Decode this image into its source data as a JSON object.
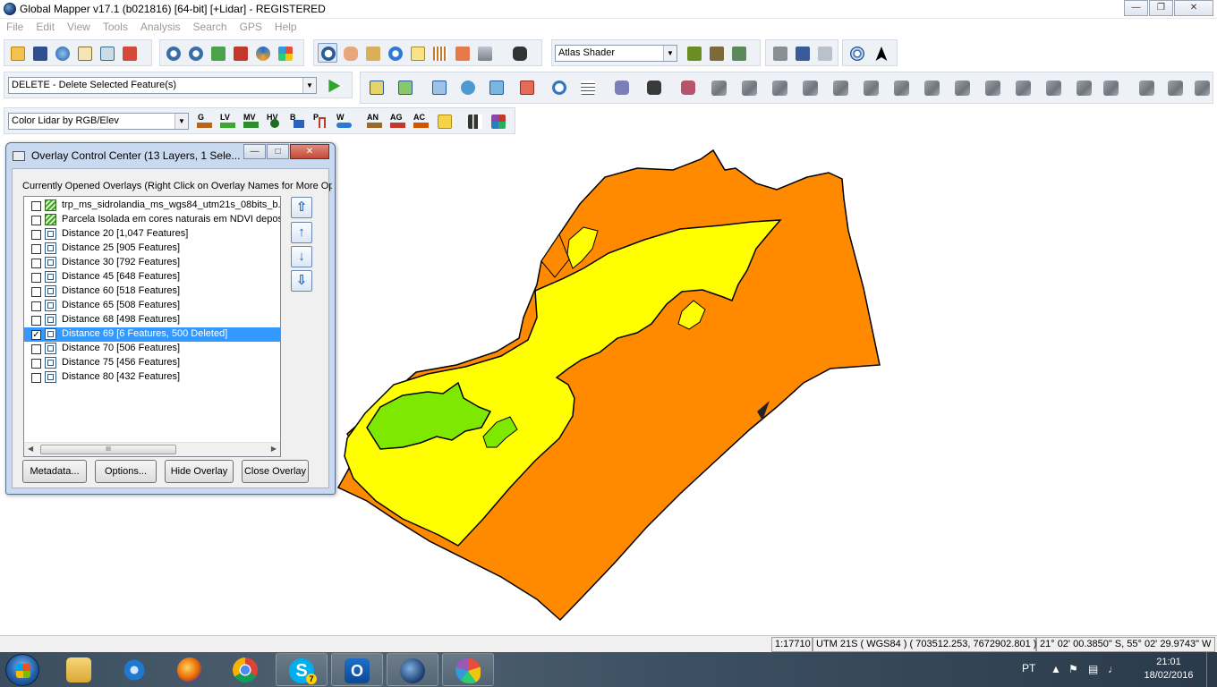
{
  "window": {
    "title": "Global Mapper v17.1 (b021816) [64-bit] [+Lidar] - REGISTERED",
    "controls": [
      "minimize",
      "restore",
      "close"
    ]
  },
  "menu": [
    "File",
    "Edit",
    "View",
    "Tools",
    "Analysis",
    "Search",
    "GPS",
    "Help"
  ],
  "toolbar": {
    "shader_select": "Atlas Shader",
    "digitizer_tool_select": "DELETE - Delete Selected Feature(s)",
    "lidar_color_select": "Color Lidar by RGB/Elev",
    "lidar_class_buttons": [
      "G",
      "LV",
      "MV",
      "HV",
      "B",
      "P",
      "W"
    ],
    "annotation_buttons": [
      "AN",
      "AG",
      "AC"
    ]
  },
  "overlay_control_center": {
    "title": "Overlay Control Center (13 Layers, 1 Sele...",
    "header": "Currently Opened Overlays (Right Click on Overlay Names for More Options)",
    "layers": [
      {
        "name": "trp_ms_sidrolandia_ms_wgs84_utm21s_08bits_b...",
        "checked": false,
        "kind": "raster"
      },
      {
        "name": "Parcela Isolada em cores naturais em NDVI deposito",
        "checked": false,
        "kind": "raster"
      },
      {
        "name": "Distance 20 [1,047 Features]",
        "checked": false,
        "kind": "vector"
      },
      {
        "name": "Distance 25 [905 Features]",
        "checked": false,
        "kind": "vector"
      },
      {
        "name": "Distance 30 [792 Features]",
        "checked": false,
        "kind": "vector"
      },
      {
        "name": "Distance 45 [648 Features]",
        "checked": false,
        "kind": "vector"
      },
      {
        "name": "Distance 60 [518 Features]",
        "checked": false,
        "kind": "vector"
      },
      {
        "name": "Distance 65 [508 Features]",
        "checked": false,
        "kind": "vector"
      },
      {
        "name": "Distance 68 [498 Features]",
        "checked": false,
        "kind": "vector"
      },
      {
        "name": "Distance 69 [6 Features, 500 Deleted]",
        "checked": true,
        "kind": "vector",
        "selected": true
      },
      {
        "name": "Distance 70 [506 Features]",
        "checked": false,
        "kind": "vector"
      },
      {
        "name": "Distance 75 [456 Features]",
        "checked": false,
        "kind": "vector"
      },
      {
        "name": "Distance 80 [432 Features]",
        "checked": false,
        "kind": "vector"
      }
    ],
    "buttons": {
      "metadata": "Metadata...",
      "options": "Options...",
      "hide": "Hide Overlay",
      "close": "Close Overlay"
    },
    "scroll_grip": "III"
  },
  "map": {
    "colors": {
      "outer": "#ff8a00",
      "middle": "#ffff00",
      "inner": "#7fe800",
      "edge": "#000000"
    }
  },
  "statusbar": {
    "scale": "1:17710",
    "projection": "UTM 21S ( WGS84 ) ( 703512.253, 7672902.801 )",
    "latlon": "21° 02' 00.3850\" S, 55° 02' 29.9743\" W"
  },
  "taskbar": {
    "apps": [
      "file-explorer",
      "internet-explorer",
      "firefox",
      "chrome",
      "skype",
      "outlook",
      "global-mapper",
      "paint"
    ],
    "skype_badge": "7",
    "language": "PT",
    "time": "21:01",
    "date": "18/02/2016"
  }
}
